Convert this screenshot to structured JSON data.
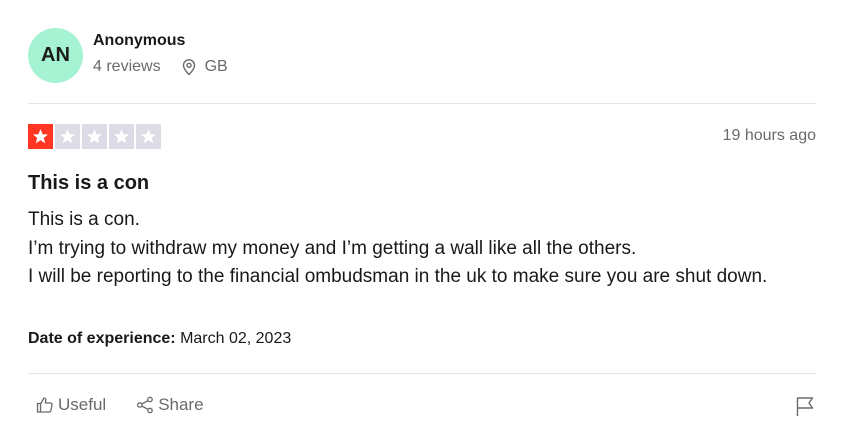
{
  "consumer": {
    "initials": "AN",
    "name": "Anonymous",
    "reviews": "4 reviews",
    "country": "GB",
    "avatar_color": "#a6f3d4"
  },
  "review": {
    "rating": 1,
    "max_rating": 5,
    "star_color": "#ff3722",
    "empty_star_color": "#dcdce6",
    "posted": "19 hours ago",
    "title": "This is a con",
    "body_lines": [
      "This is a con.",
      "I’m trying to withdraw my money and I’m getting a wall like all the others.",
      "I will be reporting to the financial ombudsman in the uk to make sure you are shut down."
    ],
    "experience_label": "Date of experience:",
    "experience_date": "March 02, 2023"
  },
  "actions": {
    "useful_label": "Useful",
    "share_label": "Share",
    "icons": [
      "thumbs-up-icon",
      "share-icon",
      "flag-icon",
      "location-pin-icon",
      "star-icon"
    ]
  }
}
